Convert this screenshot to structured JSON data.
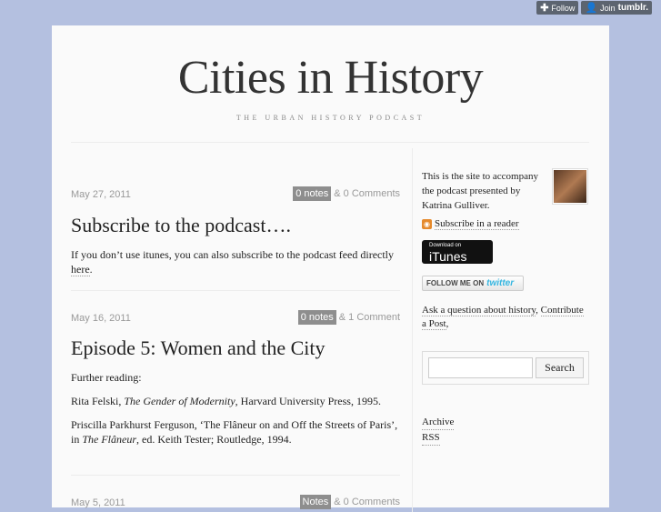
{
  "tumblr": {
    "follow": "Follow",
    "join": "Join",
    "brand": "tumblr."
  },
  "blog": {
    "title": "Cities in History",
    "tagline": "THE URBAN HISTORY PODCAST"
  },
  "posts": [
    {
      "date": "May 27, 2011",
      "notes": "0 notes",
      "amp": "&",
      "comments": "0 Comments",
      "title": "Subscribe to the podcast….",
      "body_before": "If you don’t use itunes, you can also subscribe to the podcast feed directly ",
      "body_link": "here",
      "body_after": "."
    },
    {
      "date": "May 16, 2011",
      "notes": "0 notes",
      "amp": "&",
      "comments": "1 Comment",
      "title": "Episode 5: Women and the City",
      "p1": "Further reading:",
      "p2_a": "Rita Felski, ",
      "p2_i": "The Gender of Modernity",
      "p2_b": ", Harvard University Press, 1995.",
      "p3_a": "Priscilla Parkhurst Ferguson, ‘The Flâneur on and Off the Streets of Paris’, in ",
      "p3_i": "The Flâneur",
      "p3_b": ", ed. Keith Tester; Routledge, 1994."
    },
    {
      "date": "May 5, 2011",
      "notes": "Notes",
      "amp": "&",
      "comments": "0 Comments"
    }
  ],
  "sidebar": {
    "description": "This is the site to accompany the podcast presented by Katrina Gulliver.",
    "rss": "Subscribe in a reader",
    "itunes_small": "Download on",
    "itunes_big": "iTunes",
    "twitter_prefix": "FOLLOW ME ON",
    "twitter_brand": "twitter",
    "ask_link": "Ask a question about history",
    "ask_comma": ",",
    "contribute": "Contribute a Post",
    "contribute_comma": ",",
    "search_button": "Search",
    "archive": "Archive",
    "rss_link": "RSS"
  }
}
